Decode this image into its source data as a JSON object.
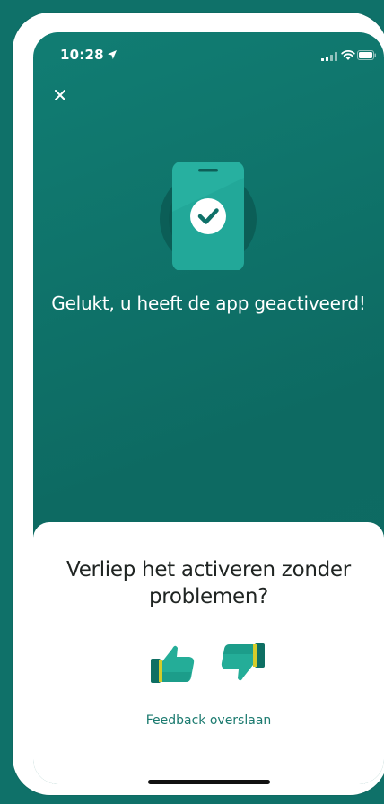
{
  "status_bar": {
    "time": "10:28",
    "icons": [
      "location-arrow-icon",
      "signal-icon",
      "wifi-icon",
      "battery-icon"
    ]
  },
  "header": {
    "close_icon": "close-icon"
  },
  "success": {
    "illustration": "phone-checkmark-icon",
    "message": "Gelukt, u heeft de app geactiveerd!"
  },
  "feedback": {
    "question": "Verliep het activeren zonder problemen?",
    "thumbs_up_icon": "thumbs-up-icon",
    "thumbs_down_icon": "thumbs-down-icon",
    "skip_label": "Feedback overslaan"
  },
  "colors": {
    "primary": "#0f7169",
    "accent": "#1b7a6f",
    "sheet_background": "#ffffff",
    "thumb_accent": "#d4cc2a"
  }
}
